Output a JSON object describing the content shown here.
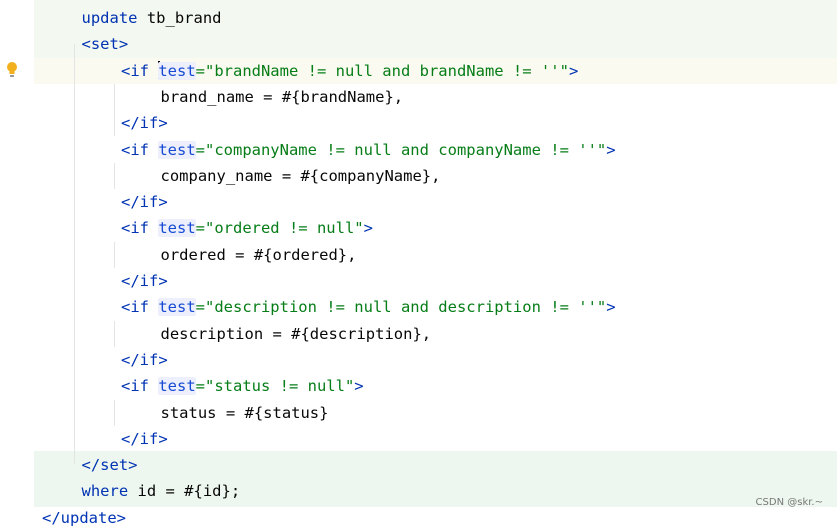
{
  "editor": {
    "lines": [
      {
        "indent": 1,
        "tokens": [
          {
            "t": "kw",
            "v": "update"
          },
          {
            "t": "plain",
            "v": " tb_brand"
          }
        ]
      },
      {
        "indent": 1,
        "tokens": [
          {
            "t": "tag",
            "v": "<set>"
          }
        ]
      },
      {
        "indent": 2,
        "caret": true,
        "tokens": [
          {
            "t": "tag",
            "v": "<if "
          },
          {
            "t": "attr",
            "v": "test"
          },
          {
            "t": "str",
            "v": "=\"brandName != null and brandName != ''\""
          },
          {
            "t": "tag",
            "v": ">"
          }
        ]
      },
      {
        "indent": 3,
        "tokens": [
          {
            "t": "plain",
            "v": "brand_name = #{brandName},"
          }
        ]
      },
      {
        "indent": 2,
        "tokens": [
          {
            "t": "tag",
            "v": "</if>"
          }
        ]
      },
      {
        "indent": 2,
        "tokens": [
          {
            "t": "tag",
            "v": "<if "
          },
          {
            "t": "attr",
            "v": "test"
          },
          {
            "t": "str",
            "v": "=\"companyName != null and companyName != ''\""
          },
          {
            "t": "tag",
            "v": ">"
          }
        ]
      },
      {
        "indent": 3,
        "tokens": [
          {
            "t": "plain",
            "v": "company_name = #{companyName},"
          }
        ]
      },
      {
        "indent": 2,
        "tokens": [
          {
            "t": "tag",
            "v": "</if>"
          }
        ]
      },
      {
        "indent": 2,
        "tokens": [
          {
            "t": "tag",
            "v": "<if "
          },
          {
            "t": "attr",
            "v": "test"
          },
          {
            "t": "str",
            "v": "=\"ordered != null\""
          },
          {
            "t": "tag",
            "v": ">"
          }
        ]
      },
      {
        "indent": 3,
        "tokens": [
          {
            "t": "plain",
            "v": "ordered = #{ordered},"
          }
        ]
      },
      {
        "indent": 2,
        "tokens": [
          {
            "t": "tag",
            "v": "</if>"
          }
        ]
      },
      {
        "indent": 2,
        "tokens": [
          {
            "t": "tag",
            "v": "<if "
          },
          {
            "t": "attr",
            "v": "test"
          },
          {
            "t": "str",
            "v": "=\"description != null and description != ''\""
          },
          {
            "t": "tag",
            "v": ">"
          }
        ]
      },
      {
        "indent": 3,
        "tokens": [
          {
            "t": "plain",
            "v": "description = #{description},"
          }
        ]
      },
      {
        "indent": 2,
        "tokens": [
          {
            "t": "tag",
            "v": "</if>"
          }
        ]
      },
      {
        "indent": 2,
        "tokens": [
          {
            "t": "tag",
            "v": "<if "
          },
          {
            "t": "attr",
            "v": "test"
          },
          {
            "t": "str",
            "v": "=\"status != null\""
          },
          {
            "t": "tag",
            "v": ">"
          }
        ]
      },
      {
        "indent": 3,
        "tokens": [
          {
            "t": "plain",
            "v": "status = #{status}"
          }
        ]
      },
      {
        "indent": 2,
        "tokens": [
          {
            "t": "tag",
            "v": "</if>"
          }
        ]
      },
      {
        "indent": 1,
        "tokens": [
          {
            "t": "tag",
            "v": "</set>"
          }
        ]
      },
      {
        "indent": 1,
        "tokens": [
          {
            "t": "kw",
            "v": "where"
          },
          {
            "t": "plain",
            "v": " id = #{id};"
          }
        ]
      },
      {
        "indent": 0,
        "tokens": [
          {
            "t": "tag",
            "v": "</update>"
          }
        ]
      }
    ]
  },
  "gutter": {
    "intention_icon": "lightbulb-icon"
  },
  "watermark": {
    "text": "CSDN @skr.~"
  },
  "colors": {
    "keyword": "#0033b3",
    "string": "#067d17",
    "attribute_bg": "#edf0fc",
    "highlight": "#eef7ee"
  }
}
